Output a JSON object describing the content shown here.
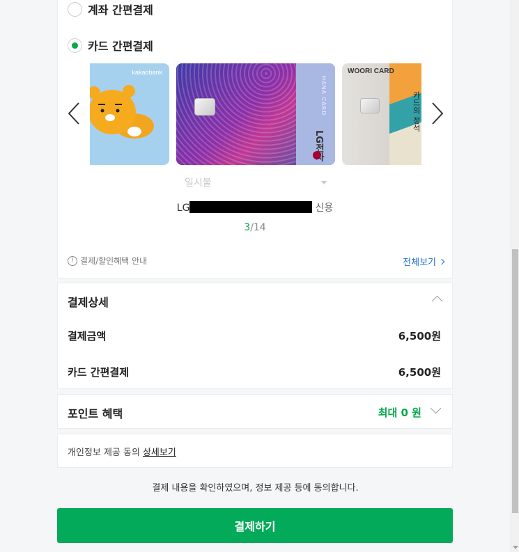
{
  "payment_methods": {
    "account_option": {
      "label": "계좌 간편결제",
      "selected": false
    },
    "card_option": {
      "label": "카드 간편결제",
      "selected": true
    },
    "cards": [
      {
        "brand": "kakaobank"
      },
      {
        "brand": "LG전자",
        "subtitle": "HANA CARD"
      },
      {
        "brand": "WOORI CARD",
        "art_text": "카드의 정석"
      }
    ],
    "installment_value": "일시불",
    "selected_card": {
      "prefix": "LG",
      "suffix": "신용"
    },
    "index": {
      "current": "3",
      "total": "/14"
    },
    "benefit_info": "결제/할인혜택 안내",
    "view_all": "전체보기"
  },
  "payment_detail": {
    "title": "결제상세",
    "rows": [
      {
        "label": "결제금액",
        "value": "6,500원"
      },
      {
        "label": "카드 간편결제",
        "value": "6,500원"
      }
    ]
  },
  "points": {
    "title": "포인트 혜택",
    "value": "최대 0 원"
  },
  "privacy": {
    "text": "개인정보 제공 동의",
    "link": "상세보기"
  },
  "agreement_text": "결제 내용을 확인하였으며, 정보 제공 등에 동의합니다.",
  "pay_button": {
    "label": "결제하기"
  },
  "colors": {
    "accent": "#03aa59",
    "link": "#1b6fd1"
  }
}
